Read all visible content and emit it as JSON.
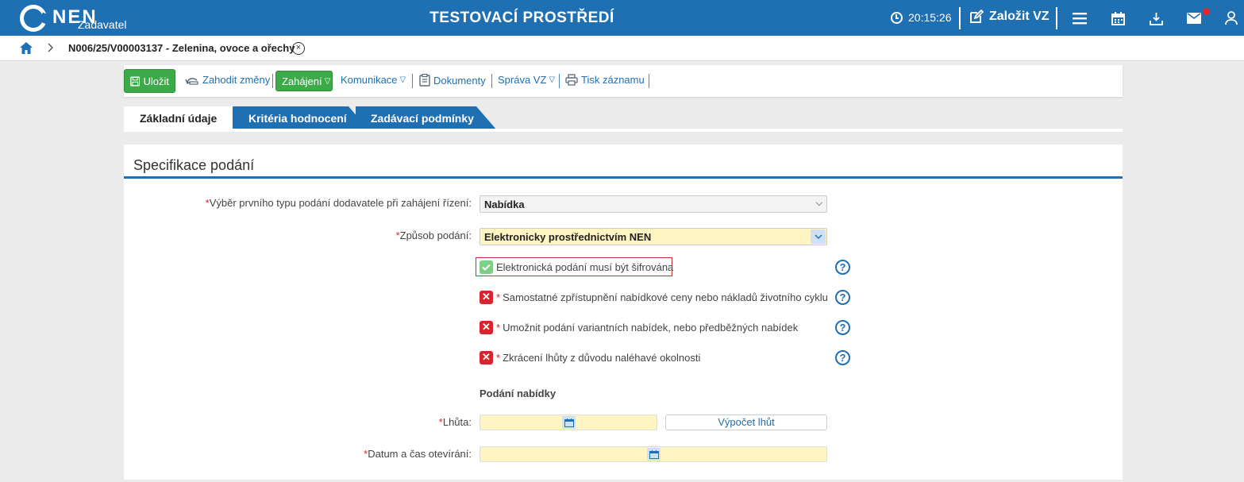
{
  "topbar": {
    "logo_text": "NEN",
    "logo_sub": "Zadavatel",
    "environment": "TESTOVACÍ PROSTŘEDÍ",
    "time": "20:15:26",
    "new_vz": "Založit VZ",
    "brand_color": "#1f6fb3",
    "icons": [
      "clock-icon",
      "edit-icon",
      "menu-icon",
      "calendar-icon",
      "download-icon",
      "mail-icon",
      "user-icon"
    ]
  },
  "breadcrumb": {
    "title": "N006/25/V00003137 - Zelenina, ovoce a ořechy",
    "close": "⊗"
  },
  "toolbar": {
    "save": "Uložit",
    "discard": "Zahodit změny",
    "start": "Zahájení",
    "communication": "Komunikace",
    "documents": "Dokumenty",
    "management": "Správa VZ",
    "print": "Tisk záznamu",
    "dropdown_marker": "▽"
  },
  "tabs": [
    "Základní údaje",
    "Kritéria hodnocení",
    "Zadávací podmínky"
  ],
  "panel": {
    "title": "Specifikace podání",
    "required_mark": "*",
    "first_submission": {
      "label": "Výběr prvního typu podání dodavatele při zahájení řízení:",
      "value": "Nabídka"
    },
    "submission_method": {
      "label": "Způsob podání:",
      "value": "Elektronicky prostřednictvím NEN"
    },
    "flags": [
      {
        "label": "Elektronická podání musí být šifrována",
        "checked": true,
        "required": false
      },
      {
        "label": "Samostatné zpřístupnění nabídkové ceny nebo nákladů životního cyklu",
        "checked": false,
        "required": true
      },
      {
        "label": "Umožnit podání variantních nabídek, nebo předběžných nabídek",
        "checked": false,
        "required": true
      },
      {
        "label": "Zkrácení lhůty z důvodu naléhavé okolnosti",
        "checked": false,
        "required": true
      }
    ],
    "offer_section": "Podání nabídky",
    "deadline_label": "Lhůta:",
    "calc_button": "Výpočet lhůt",
    "opening_label": "Datum a čas otevírání:",
    "help_symbol": "?"
  }
}
